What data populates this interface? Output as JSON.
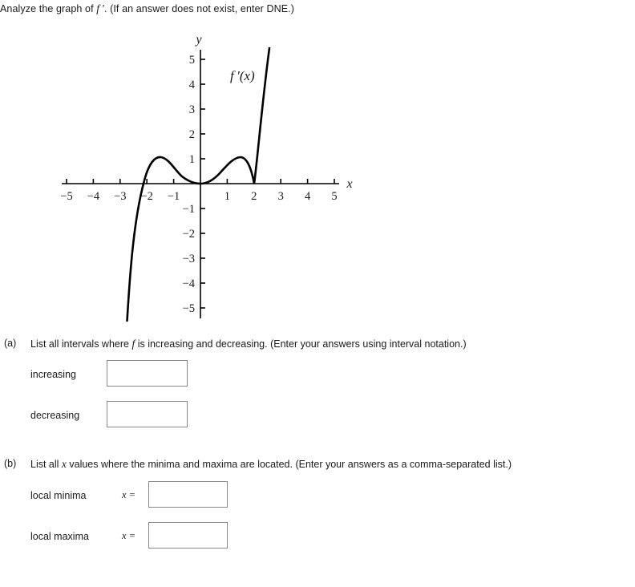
{
  "prompt": {
    "lead": "Analyze the graph of ",
    "fprime": "f ′",
    "tail": ". (If an answer does not exist, enter DNE.)"
  },
  "graph": {
    "curve_label": "f ′(x)",
    "x_axis_label": "x",
    "y_axis_label": "y",
    "x_tick_labels": [
      "−5",
      "−4",
      "−3",
      "−2",
      "−1",
      "1",
      "2",
      "3",
      "4",
      "5"
    ],
    "y_tick_labels_positive": [
      "1",
      "2",
      "3",
      "4",
      "5"
    ],
    "y_tick_labels_negative": [
      "−1",
      "−2",
      "−3",
      "−4",
      "−5"
    ],
    "stroke_color": "#000000",
    "axis_color": "#000000"
  },
  "chart_data": {
    "type": "line",
    "title": "",
    "xlabel": "x",
    "ylabel": "y",
    "xlim": [
      -5.5,
      5.5
    ],
    "ylim": [
      -5.6,
      5.8
    ],
    "grid": false,
    "legend": "f ′(x)",
    "xticks": [
      -5,
      -4,
      -3,
      -2,
      -1,
      1,
      2,
      3,
      4,
      5
    ],
    "yticks": [
      -5,
      -4,
      -3,
      -2,
      -1,
      1,
      2,
      3,
      4,
      5
    ],
    "series": [
      {
        "name": "f'(x)",
        "description": "Graph of the derivative f'(x): rises steeply from below -5 near x=-2.4, crosses zero at x=-2.1, local max of 1 at x=-1.5, touches zero at x=0, local max of 1 at x=1.35, touches zero at x=2, then rises steeply off the top of the plot.",
        "x": [
          -2.45,
          -2.3,
          -2.1,
          -2.0,
          -1.8,
          -1.5,
          -1.2,
          -0.9,
          -0.6,
          -0.3,
          0.0,
          0.35,
          0.7,
          1.0,
          1.35,
          1.6,
          1.8,
          2.0,
          2.15,
          2.3,
          2.45,
          2.55
        ],
        "y": [
          -5.6,
          -3.2,
          0.0,
          0.45,
          0.92,
          1.0,
          0.9,
          0.65,
          0.36,
          0.1,
          0.0,
          0.15,
          0.6,
          0.9,
          1.0,
          0.75,
          0.42,
          0.0,
          1.2,
          2.9,
          5.0,
          5.8
        ]
      }
    ],
    "zeros": [
      -2.1,
      0,
      2
    ],
    "local_maxima_of_curve": [
      {
        "x": -1.5,
        "y": 1
      },
      {
        "x": 1.35,
        "y": 1
      }
    ],
    "local_minima_of_curve": [
      {
        "x": 0,
        "y": 0
      },
      {
        "x": 2,
        "y": 0
      }
    ]
  },
  "part_a": {
    "marker": "(a)",
    "question_pre": "List all intervals where ",
    "question_var": "f",
    "question_post": " is increasing and decreasing. (Enter your answers using interval notation.)",
    "increasing_label": "increasing",
    "increasing_value": "",
    "decreasing_label": "decreasing",
    "decreasing_value": ""
  },
  "part_b": {
    "marker": "(b)",
    "question_pre": "List all ",
    "question_var": "x",
    "question_post": " values where the minima and maxima are located. (Enter your answers as a comma-separated list.)",
    "minima_label": "local minima",
    "minima_eq": "x  =",
    "minima_value": "",
    "maxima_label": "local maxima",
    "maxima_eq": "x  =",
    "maxima_value": ""
  }
}
